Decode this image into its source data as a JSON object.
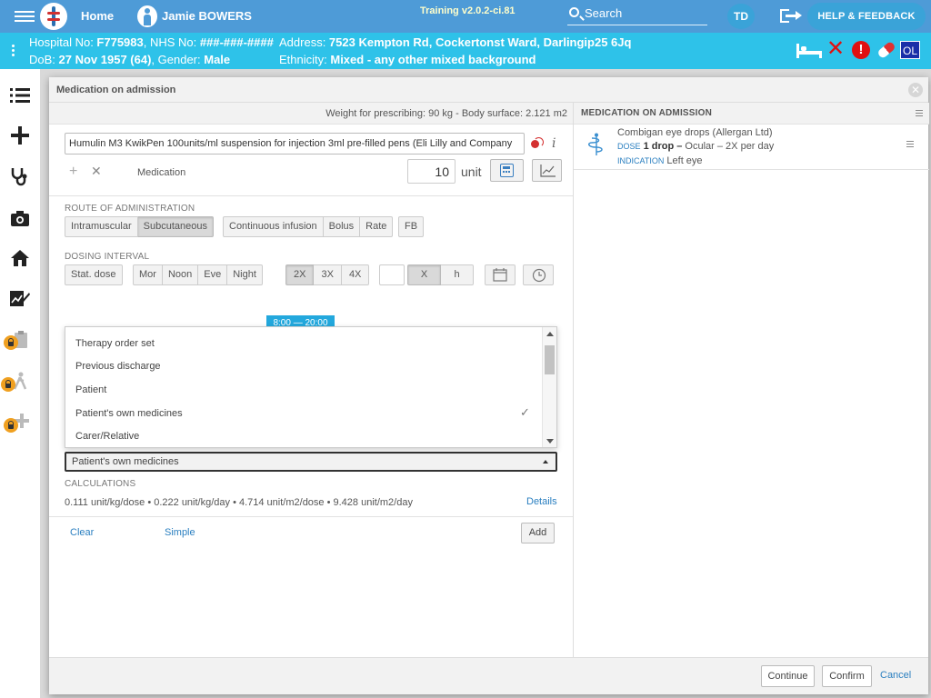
{
  "topbar": {
    "home_label": "Home",
    "patient_name": "Jamie BOWERS",
    "version": "Training v2.0.2-ci.81",
    "search_label": "Search",
    "avatar_initials": "TD",
    "help_label": "HELP & FEEDBACK",
    "accent_color": "#4e9bd7"
  },
  "banner": {
    "hospital_label": "Hospital No: ",
    "hospital_no": "F775983",
    "nhs_label": ", NHS No: ",
    "nhs_no": "###-###-####",
    "dob_label": "DoB: ",
    "dob": "27 Nov 1957 (64)",
    "gender_label": ", Gender: ",
    "gender": "Male",
    "address_label": "Address: ",
    "address": "7523 Kempton Rd, Cockertonst Ward, Darlingip25 6Jq",
    "ethnicity_label": "Ethnicity: ",
    "ethnicity": "Mixed - any other mixed background",
    "ol_badge": "OL",
    "alert_badge": "!",
    "color": "#2ec2e9"
  },
  "sidebar": {
    "items": [
      "list-icon",
      "plus-icon",
      "stethoscope-icon",
      "camera-icon",
      "house-icon",
      "chart-edit-icon",
      "locked-clipboard-icon",
      "locked-walker-icon",
      "locked-add-icon"
    ]
  },
  "modal": {
    "title": "Medication on admission",
    "weight_text": "Weight for prescribing: 90 kg - Body surface: 2.121 m2",
    "drug_value": "Humulin M3 KwikPen 100units/ml suspension for injection 3ml pre-filled pens (Eli Lilly and Company",
    "medication_label": "Medication",
    "dose_value": "10",
    "unit_label": "unit",
    "route_label": "ROUTE OF ADMINISTRATION",
    "routes_a": [
      "Intramuscular",
      "Subcutaneous"
    ],
    "routes_b": [
      "Continuous infusion",
      "Bolus",
      "Rate"
    ],
    "fb_label": "FB",
    "dosing_label": "DOSING INTERVAL",
    "stat_label": "Stat. dose",
    "times": [
      "Mor",
      "Noon",
      "Eve",
      "Night"
    ],
    "freq": [
      "2X",
      "3X",
      "4X"
    ],
    "xh": [
      "X",
      "h"
    ],
    "time_tip": "8:00 — 20:00",
    "source_options": [
      "Therapy order set",
      "Previous discharge",
      "Patient",
      "Patient's own medicines",
      "Carer/Relative"
    ],
    "selected_source": "Patient's own medicines",
    "calculations_label": "CALCULATIONS",
    "calculations_text": "0.111 unit/kg/dose • 0.222 unit/kg/day • 4.714 unit/m2/dose • 9.428 unit/m2/day",
    "details_label": "Details",
    "clear_label": "Clear",
    "simple_label": "Simple",
    "add_label": "Add"
  },
  "right_pane": {
    "title": "MEDICATION ON ADMISSION",
    "card": {
      "name": "Combigan eye drops (Allergan Ltd)",
      "dose_key": "DOSE",
      "dose_bold": "1 drop –",
      "dose_rest": " Ocular – 2X per day",
      "indication_key": "INDICATION",
      "indication": "Left eye"
    }
  },
  "footer": {
    "continue_label": "Continue",
    "confirm_label": "Confirm",
    "cancel_label": "Cancel"
  }
}
